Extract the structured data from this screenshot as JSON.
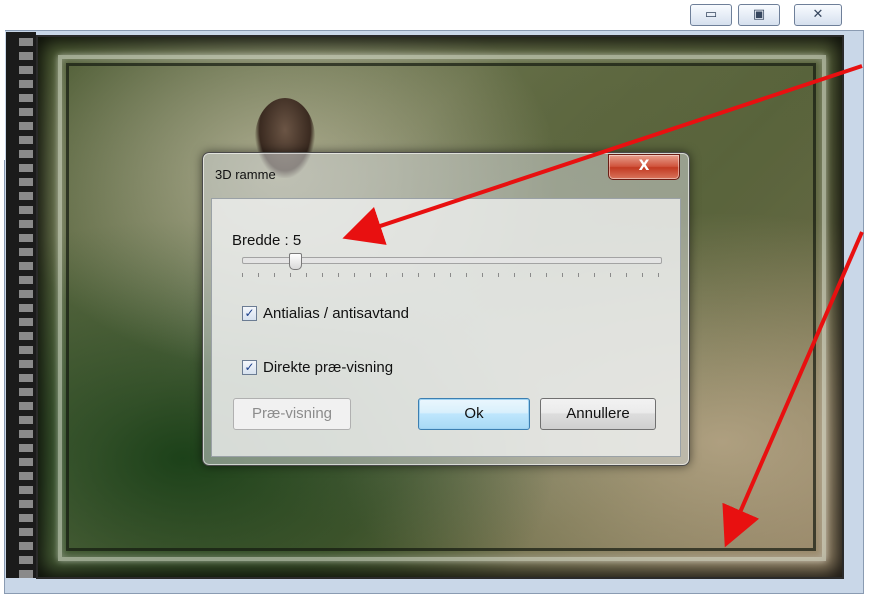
{
  "window": {
    "caption_min": "▭",
    "caption_max": "▣",
    "caption_close": "✕"
  },
  "dialog": {
    "title": "3D ramme",
    "close_label": "X",
    "width_label": "Bredde : 5",
    "slider_value": 5,
    "slider_max": 40,
    "antialias_label": "Antialias / antisavtand",
    "antialias_checked": true,
    "direct_preview_label": "Direkte præ-visning",
    "direct_preview_checked": true,
    "preview_button": "Præ-visning",
    "ok_button": "Ok",
    "cancel_button": "Annullere"
  },
  "annotations": {
    "arrow_color": "#e81010"
  }
}
